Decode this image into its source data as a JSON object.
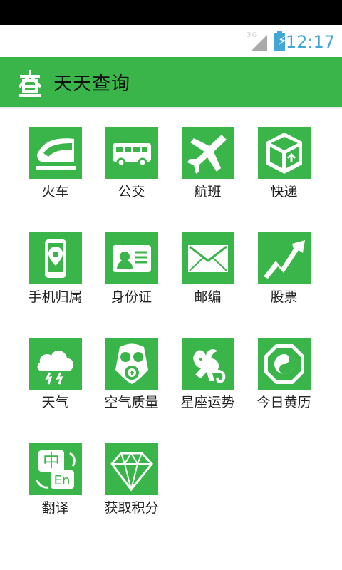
{
  "status_bar": {
    "network": "3G",
    "time": "12:17"
  },
  "header": {
    "title": "天天查询"
  },
  "grid_items": [
    {
      "label": "火车",
      "icon": "train-icon"
    },
    {
      "label": "公交",
      "icon": "bus-icon"
    },
    {
      "label": "航班",
      "icon": "airplane-icon"
    },
    {
      "label": "快递",
      "icon": "package-icon"
    },
    {
      "label": "手机归属",
      "icon": "phone-location-icon"
    },
    {
      "label": "身份证",
      "icon": "id-card-icon"
    },
    {
      "label": "邮编",
      "icon": "mail-icon"
    },
    {
      "label": "股票",
      "icon": "stock-chart-icon"
    },
    {
      "label": "天气",
      "icon": "weather-cloud-icon"
    },
    {
      "label": "空气质量",
      "icon": "gas-mask-icon"
    },
    {
      "label": "星座运势",
      "icon": "capricorn-icon"
    },
    {
      "label": "今日黄历",
      "icon": "yin-yang-bagua-icon"
    },
    {
      "label": "翻译",
      "icon": "translate-icon"
    },
    {
      "label": "获取积分",
      "icon": "diamond-icon"
    }
  ],
  "colors": {
    "accent": "#39b54a",
    "status_time": "#43a7d6"
  }
}
